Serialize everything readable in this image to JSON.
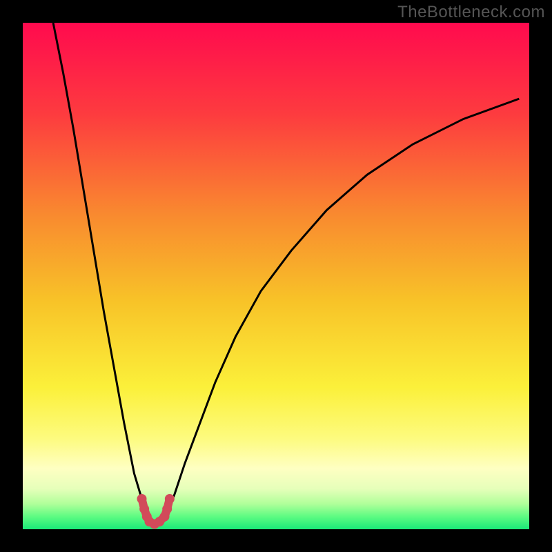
{
  "watermark": "TheBottleneck.com",
  "colors": {
    "background": "#000000",
    "curve": "#000000",
    "marker": "#d24a5a"
  },
  "chart_data": {
    "type": "line",
    "title": "",
    "xlabel": "",
    "ylabel": "",
    "xlim": [
      0,
      100
    ],
    "ylim": [
      0,
      100
    ],
    "grid": false,
    "legend": false,
    "gradient": [
      {
        "stop": 0.0,
        "color": "#ff0a4e"
      },
      {
        "stop": 0.18,
        "color": "#fd3b3f"
      },
      {
        "stop": 0.38,
        "color": "#f98a2f"
      },
      {
        "stop": 0.55,
        "color": "#f8c328"
      },
      {
        "stop": 0.72,
        "color": "#fbf03a"
      },
      {
        "stop": 0.82,
        "color": "#fdfb7e"
      },
      {
        "stop": 0.88,
        "color": "#feffc2"
      },
      {
        "stop": 0.92,
        "color": "#e6ffba"
      },
      {
        "stop": 0.95,
        "color": "#b0ff9a"
      },
      {
        "stop": 0.975,
        "color": "#5dfb82"
      },
      {
        "stop": 1.0,
        "color": "#1ae978"
      }
    ],
    "series": [
      {
        "name": "left-curve",
        "x": [
          6,
          8,
          10,
          12,
          14,
          16,
          18,
          20,
          22,
          23.5,
          25
        ],
        "y": [
          100,
          90,
          79,
          67,
          55,
          43,
          32,
          21,
          11,
          6,
          2
        ]
      },
      {
        "name": "right-curve",
        "x": [
          28,
          30,
          32,
          35,
          38,
          42,
          47,
          53,
          60,
          68,
          77,
          87,
          98
        ],
        "y": [
          2,
          7,
          13,
          21,
          29,
          38,
          47,
          55,
          63,
          70,
          76,
          81,
          85
        ]
      }
    ],
    "markers": {
      "name": "bottleneck-valley",
      "x": [
        23.5,
        24,
        24.5,
        25,
        26,
        27,
        28,
        28.5,
        29
      ],
      "y": [
        6,
        4,
        2.5,
        1.5,
        1,
        1.5,
        2.5,
        4,
        6
      ]
    }
  }
}
